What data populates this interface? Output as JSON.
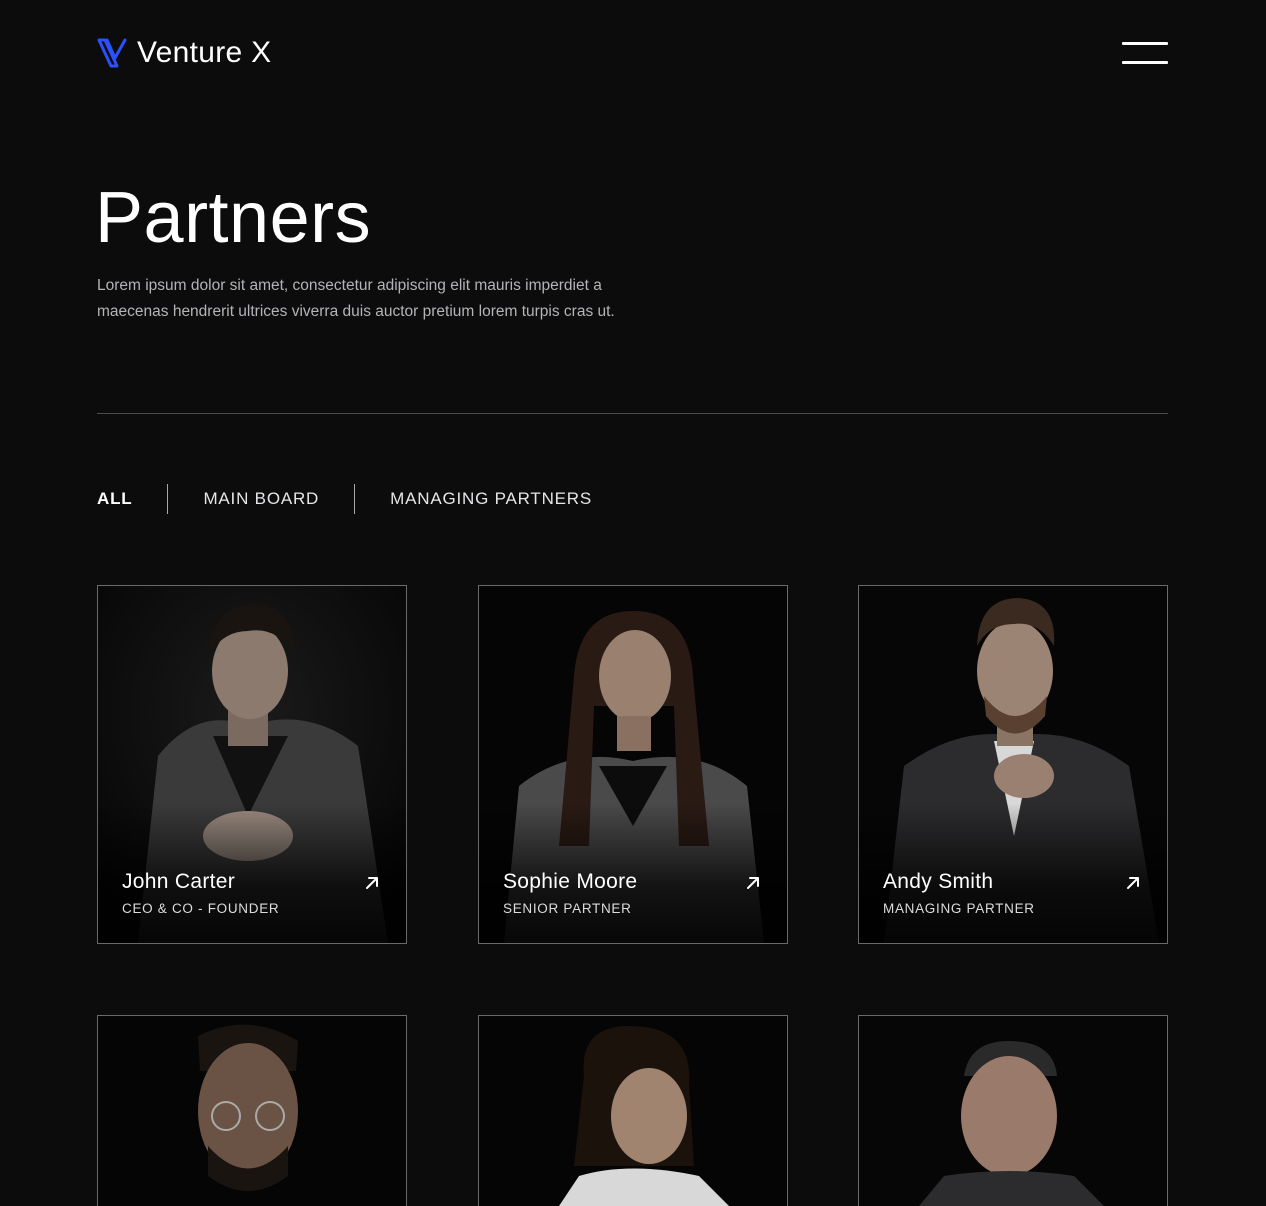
{
  "header": {
    "brand": "Venture X",
    "brand_color": "#2b50ff",
    "logo_icon": "venture-x-logo-icon",
    "menu_icon": "hamburger-menu-icon"
  },
  "hero": {
    "title": "Partners",
    "intro_line1": "Lorem ipsum dolor sit amet, consectetur adipiscing elit mauris imperdiet a",
    "intro_line2": "maecenas hendrerit ultrices viverra duis auctor pretium lorem turpis cras ut."
  },
  "filters": [
    {
      "label": "ALL",
      "active": true
    },
    {
      "label": "MAIN BOARD",
      "active": false
    },
    {
      "label": "MANAGING PARTNERS",
      "active": false
    }
  ],
  "partners": [
    {
      "name": "John Carter",
      "role": "CEO & CO - FOUNDER",
      "icon": "arrow-up-right-icon"
    },
    {
      "name": "Sophie Moore",
      "role": "SENIOR PARTNER",
      "icon": "arrow-up-right-icon"
    },
    {
      "name": "Andy Smith",
      "role": "MANAGING PARTNER",
      "icon": "arrow-up-right-icon"
    },
    {
      "name": "",
      "role": ""
    },
    {
      "name": "",
      "role": ""
    },
    {
      "name": "",
      "role": ""
    }
  ]
}
